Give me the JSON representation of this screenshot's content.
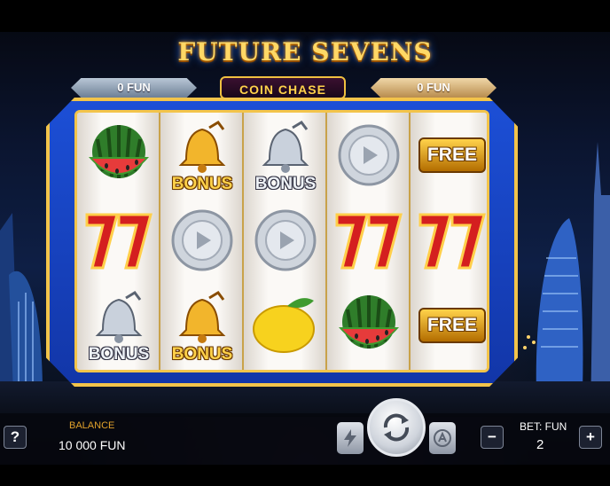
{
  "title": "FUTURE SEVENS",
  "meters": {
    "left_value": "0 FUN",
    "center_label": "COIN CHASE",
    "right_value": "0 FUN"
  },
  "reels": [
    {
      "symbols": [
        "watermelon",
        "red-seven",
        "silver-bell-bonus"
      ],
      "labels": [
        "",
        "",
        "BONUS"
      ]
    },
    {
      "symbols": [
        "gold-bell-bonus",
        "silver-coin",
        "gold-bell-bonus"
      ],
      "labels": [
        "BONUS",
        "",
        "BONUS"
      ]
    },
    {
      "symbols": [
        "silver-bell-bonus",
        "silver-coin",
        "lemon"
      ],
      "labels": [
        "BONUS",
        "",
        ""
      ]
    },
    {
      "symbols": [
        "silver-coin",
        "red-seven",
        "watermelon"
      ],
      "labels": [
        "",
        "",
        ""
      ]
    },
    {
      "symbols": [
        "free",
        "red-seven",
        "free"
      ],
      "labels": [
        "FREE",
        "",
        "FREE"
      ]
    }
  ],
  "footer": {
    "help_label": "?",
    "balance_label": "BALANCE",
    "balance_value": "10 000 FUN",
    "bet_label": "BET: FUN",
    "bet_value": "2",
    "minus_label": "−",
    "plus_label": "+",
    "turbo_icon": "lightning-icon",
    "spin_icon": "spin-arrows-icon",
    "autoplay_icon": "autoplay-icon"
  },
  "colors": {
    "frame_blue": "#1c4fd6",
    "gold": "#f3c44a",
    "title_gold": "#ffd866"
  }
}
